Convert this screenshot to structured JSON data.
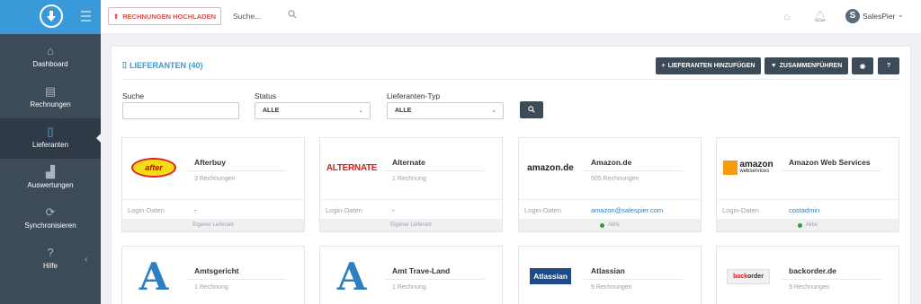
{
  "sidebar": {
    "items": [
      {
        "label": "Dashboard",
        "icon": "home-icon"
      },
      {
        "label": "Rechnungen",
        "icon": "document-icon"
      },
      {
        "label": "Lieferanten",
        "icon": "tablet-icon",
        "active": true
      },
      {
        "label": "Auswertungen",
        "icon": "chart-icon"
      },
      {
        "label": "Synchronisieren",
        "icon": "sync-icon"
      },
      {
        "label": "Hilfe",
        "icon": "help-icon"
      }
    ]
  },
  "topbar": {
    "upload_label": "RECHNUNGEN HOCHLADEN",
    "search_placeholder": "Suche...",
    "user_initial": "S",
    "username": "SalesPier"
  },
  "panel": {
    "title": "LIEFERANTEN (40)",
    "buttons": {
      "add": "LIEFERANTEN HINZUFÜGEN",
      "merge": "ZUSAMMENFÜHREN"
    },
    "filters": {
      "search_label": "Suche",
      "status_label": "Status",
      "status_value": "ALLE",
      "type_label": "Lieferanten-Typ",
      "type_value": "ALLE"
    }
  },
  "cards": [
    {
      "name": "Afterbuy",
      "sub": "3 Rechnungen",
      "login_label": "Login-Daten",
      "login_value": "-",
      "footer": "Eigener Lieferant",
      "logo": "afterbuy-logo"
    },
    {
      "name": "Alternate",
      "sub": "1 Rechnung",
      "login_label": "Login-Daten",
      "login_value": "-",
      "footer": "Eigener Lieferant",
      "logo": "alternate-logo",
      "logo_text": "ALTERNATE"
    },
    {
      "name": "Amazon.de",
      "sub": "505 Rechnungen",
      "login_label": "Login-Daten",
      "login_value": "amazon@salespier.com",
      "footer": "Aktiv",
      "logo": "amazon-logo",
      "logo_text": "amazon.de"
    },
    {
      "name": "Amazon Web Services",
      "sub": "",
      "login_label": "Login-Daten",
      "login_value": "costadmin",
      "footer": "Aktiv",
      "logo": "aws-logo",
      "logo_text": "amazon",
      "logo_sub": "webservices"
    },
    {
      "name": "Amtsgericht",
      "sub": "1 Rechnung",
      "logo": "letter-a-logo",
      "logo_text": "A"
    },
    {
      "name": "Amt Trave-Land",
      "sub": "1 Rechnung",
      "logo": "letter-a-logo",
      "logo_text": "A"
    },
    {
      "name": "Atlassian",
      "sub": "9 Rechnungen",
      "logo": "atlassian-logo",
      "logo_text": "Atlassian"
    },
    {
      "name": "backorder.de",
      "sub": "9 Rechnungen",
      "logo": "backorder-logo",
      "logo_text_red": "back",
      "logo_text_rest": "order"
    }
  ]
}
